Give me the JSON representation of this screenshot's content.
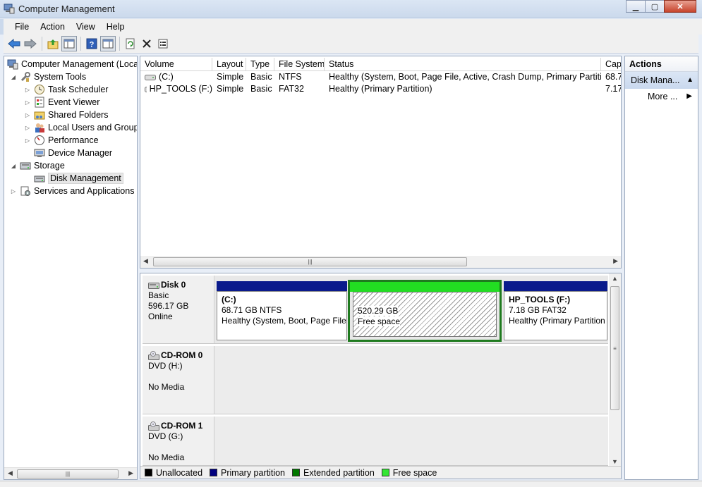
{
  "window": {
    "title": "Computer Management"
  },
  "menu": [
    "File",
    "Action",
    "View",
    "Help"
  ],
  "tree": {
    "items": [
      {
        "label": "Computer Management (Local",
        "level": 0,
        "expander": ""
      },
      {
        "label": "System Tools",
        "level": 1,
        "expander": "◢"
      },
      {
        "label": "Task Scheduler",
        "level": 2,
        "expander": "▷"
      },
      {
        "label": "Event Viewer",
        "level": 2,
        "expander": "▷"
      },
      {
        "label": "Shared Folders",
        "level": 2,
        "expander": "▷"
      },
      {
        "label": "Local Users and Groups",
        "level": 2,
        "expander": "▷"
      },
      {
        "label": "Performance",
        "level": 2,
        "expander": "▷"
      },
      {
        "label": "Device Manager",
        "level": 2,
        "expander": ""
      },
      {
        "label": "Storage",
        "level": 1,
        "expander": "◢"
      },
      {
        "label": "Disk Management",
        "level": 2,
        "expander": ""
      },
      {
        "label": "Services and Applications",
        "level": 1,
        "expander": "▷"
      }
    ]
  },
  "volumes": {
    "headers": [
      "Volume",
      "Layout",
      "Type",
      "File System",
      "Status",
      "Cap"
    ],
    "rows": [
      {
        "volume": "(C:)",
        "layout": "Simple",
        "type": "Basic",
        "fs": "NTFS",
        "status": "Healthy (System, Boot, Page File, Active, Crash Dump, Primary Partition)",
        "cap": "68.7"
      },
      {
        "volume": "HP_TOOLS (F:)",
        "layout": "Simple",
        "type": "Basic",
        "fs": "FAT32",
        "status": "Healthy (Primary Partition)",
        "cap": "7.17"
      }
    ]
  },
  "disks": {
    "disk0": {
      "name": "Disk 0",
      "type": "Basic",
      "size": "596.17 GB",
      "state": "Online",
      "partitions": [
        {
          "title": "(C:)",
          "size": "68.71 GB NTFS",
          "status": "Healthy (System, Boot, Page File"
        },
        {
          "title": "",
          "size": "520.29 GB",
          "status": "Free space"
        },
        {
          "title": "HP_TOOLS  (F:)",
          "size": "7.18 GB FAT32",
          "status": "Healthy (Primary Partition"
        }
      ]
    },
    "cdrom0": {
      "name": "CD-ROM 0",
      "type": "DVD (H:)",
      "state": "No Media"
    },
    "cdrom1": {
      "name": "CD-ROM 1",
      "type": "DVD (G:)",
      "state": "No Media"
    }
  },
  "legend": [
    {
      "label": "Unallocated",
      "color": "#000000"
    },
    {
      "label": "Primary partition",
      "color": "#000080"
    },
    {
      "label": "Extended partition",
      "color": "#007800"
    },
    {
      "label": "Free space",
      "color": "#33e633"
    }
  ],
  "actions": {
    "header": "Actions",
    "section": "Disk Mana...",
    "more": "More ..."
  },
  "colors": {
    "primary_bar": "#0a1a8c",
    "free_bar": "#22dd22",
    "selection_border": "#1f7a1f"
  }
}
